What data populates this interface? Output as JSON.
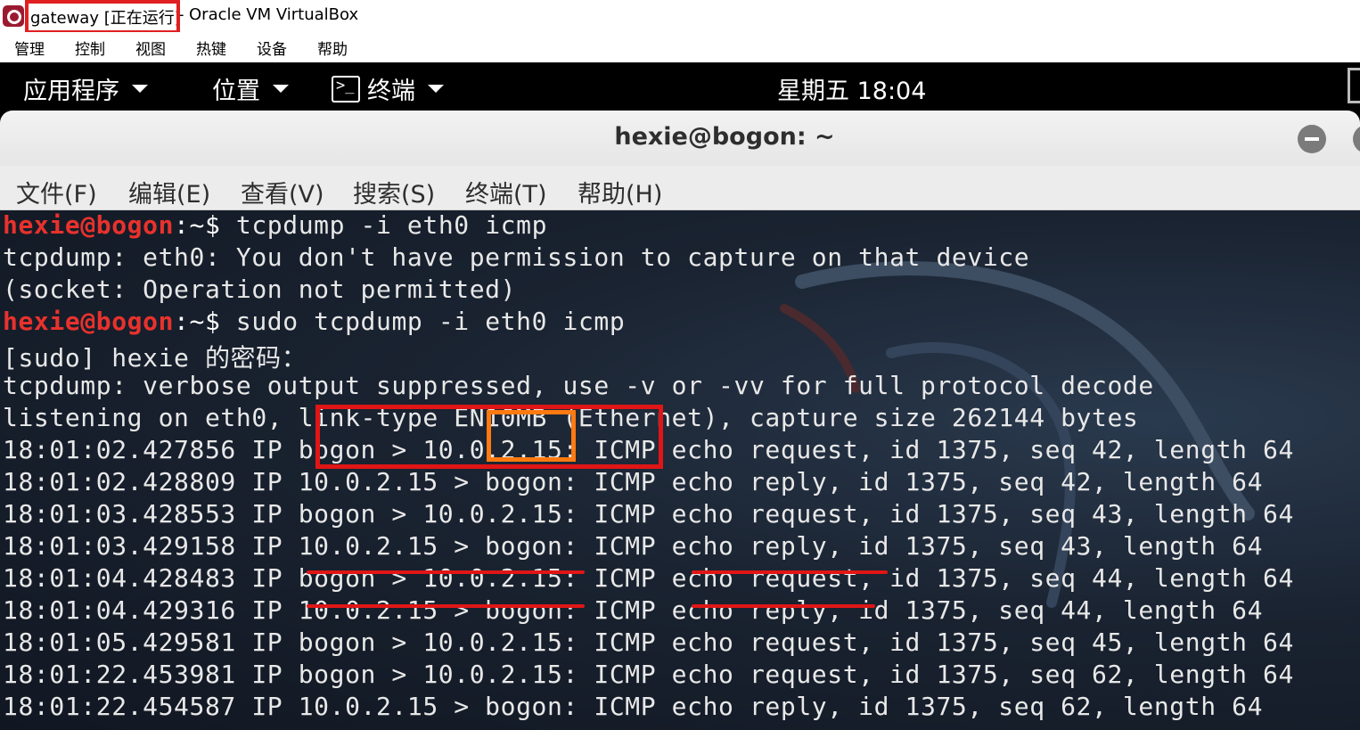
{
  "vbox": {
    "title_vm": "gateway [正在运行]",
    "title_sep": "-",
    "title_app": "Oracle VM VirtualBox",
    "menu": [
      "管理",
      "控制",
      "视图",
      "热键",
      "设备",
      "帮助"
    ]
  },
  "topbar": {
    "applications": "应用程序",
    "places": "位置",
    "terminal": "终端",
    "clock": "星期五 18:04"
  },
  "terminal": {
    "title": "hexie@bogon: ~",
    "menu": [
      "文件(F)",
      "编辑(E)",
      "查看(V)",
      "搜索(S)",
      "终端(T)",
      "帮助(H)"
    ],
    "prompt_user": "hexie@bogon",
    "prompt_path": ":~$ ",
    "lines": [
      {
        "prompt": true,
        "text": "tcpdump -i eth0 icmp"
      },
      {
        "prompt": false,
        "text": "tcpdump: eth0: You don't have permission to capture on that device"
      },
      {
        "prompt": false,
        "text": "(socket: Operation not permitted)"
      },
      {
        "prompt": true,
        "text": "sudo tcpdump -i eth0 icmp"
      },
      {
        "prompt": false,
        "text": "[sudo] hexie 的密码："
      },
      {
        "prompt": false,
        "text": "tcpdump: verbose output suppressed, use -v or -vv for full protocol decode"
      },
      {
        "prompt": false,
        "text": "listening on eth0, link-type EN10MB (Ethernet), capture size 262144 bytes"
      },
      {
        "prompt": false,
        "text": "18:01:02.427856 IP bogon > 10.0.2.15: ICMP echo request, id 1375, seq 42, length 64"
      },
      {
        "prompt": false,
        "text": "18:01:02.428809 IP 10.0.2.15 > bogon: ICMP echo reply, id 1375, seq 42, length 64"
      },
      {
        "prompt": false,
        "text": "18:01:03.428553 IP bogon > 10.0.2.15: ICMP echo request, id 1375, seq 43, length 64"
      },
      {
        "prompt": false,
        "text": "18:01:03.429158 IP 10.0.2.15 > bogon: ICMP echo reply, id 1375, seq 43, length 64"
      },
      {
        "prompt": false,
        "text": "18:01:04.428483 IP bogon > 10.0.2.15: ICMP echo request, id 1375, seq 44, length 64"
      },
      {
        "prompt": false,
        "text": "18:01:04.429316 IP 10.0.2.15 > bogon: ICMP echo reply, id 1375, seq 44, length 64"
      },
      {
        "prompt": false,
        "text": "18:01:05.429581 IP bogon > 10.0.2.15: ICMP echo request, id 1375, seq 45, length 64"
      },
      {
        "prompt": false,
        "text": "18:01:22.453981 IP bogon > 10.0.2.15: ICMP echo request, id 1375, seq 62, length 64"
      },
      {
        "prompt": false,
        "text": "18:01:22.454587 IP 10.0.2.15 > bogon: ICMP echo reply, id 1375, seq 62, length 64"
      }
    ]
  },
  "colors": {
    "prompt": "#e8322d",
    "highlight_red": "#e01616",
    "highlight_orange": "#ff7a10",
    "terminal_bg": "#1a2331"
  },
  "icons": [
    "virtualbox-vm-icon",
    "terminal-icon",
    "minimize-icon",
    "maximize-icon",
    "kali-dragon-icon"
  ]
}
